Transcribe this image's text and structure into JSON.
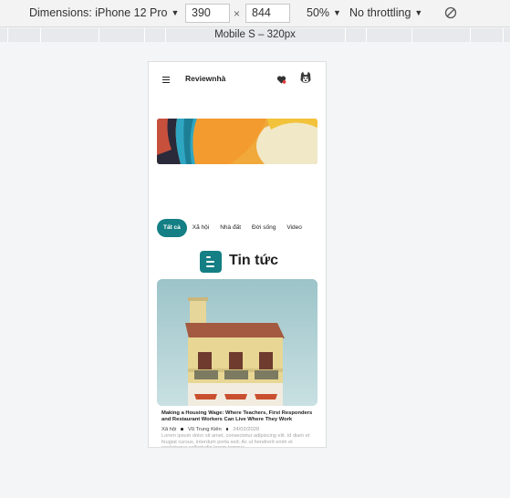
{
  "toolbar": {
    "dimensions_label": "Dimensions: iPhone 12 Pro",
    "width": "390",
    "times": "×",
    "height": "844",
    "zoom": "50%",
    "throttle": "No throttling",
    "rotate_icon": "rotate-disabled-icon"
  },
  "media_query": {
    "label": "Mobile S – 320px"
  },
  "app": {
    "logo": "Reviewnhà",
    "menu_icon": "hamburger-icon",
    "favorites_icon": "heart-icon",
    "avatar_icon": "husky-avatar-icon",
    "categories": [
      "Tất cả",
      "Xã hội",
      "Nhà đất",
      "Đời sống",
      "Video"
    ],
    "active_category": "Tất cả",
    "section_title": "Tin tức",
    "article": {
      "title": "Making a Housing Wage: Where Teachers, First Responders and Restaurant Workers Can Live Where They Work",
      "category": "Xã hội",
      "author": "Vũ Trung Kiên",
      "date": "24/02/2020",
      "excerpt": "Lorem ipsum dolor sit amet, consectetur adipiscing elit. Id diam et feugiat cursus, interdum porta sed. Ac ut hendrerit enim et scelerisque sollicitudin lorem tempus"
    }
  },
  "colors": {
    "accent": "#147f84",
    "toolbar_bg": "#f3f3f3",
    "page_bg": "#f3f5f6"
  }
}
